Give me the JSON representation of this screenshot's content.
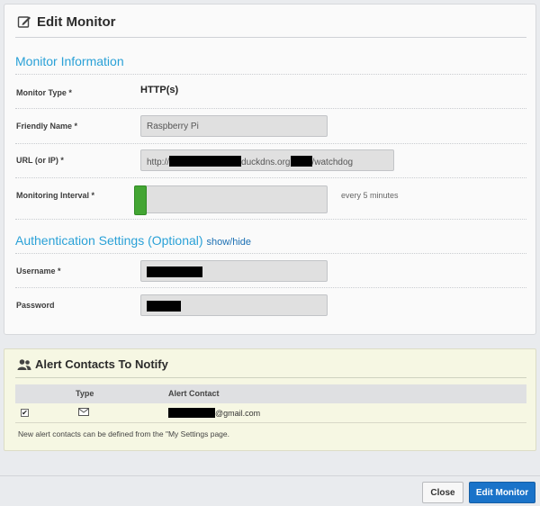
{
  "header": {
    "title": "Edit Monitor",
    "icon": "edit-icon"
  },
  "monitor_info": {
    "section_title": "Monitor Information",
    "type_label": "Monitor Type *",
    "type_value": "HTTP(s)",
    "friendly_name_label": "Friendly Name *",
    "friendly_name_value": "Raspberry Pi",
    "url_label": "URL (or IP) *",
    "url_prefix": "http://",
    "url_mid": "duckdns.org",
    "url_suffix": "/watchdog",
    "interval_label": "Monitoring Interval *",
    "interval_text": "every 5 minutes",
    "interval_slider_level": 0.0
  },
  "auth": {
    "section_title": "Authentication Settings (Optional)",
    "toggle_label": "show/hide",
    "username_label": "Username *",
    "password_label": "Password"
  },
  "alerts": {
    "title": "Alert Contacts To Notify",
    "icon": "users-icon",
    "columns": [
      "",
      "Type",
      "Alert Contact"
    ],
    "rows": [
      {
        "checked": true,
        "type_icon": "envelope-icon",
        "contact_suffix": "@gmail.com"
      }
    ],
    "note": "New alert contacts can be defined from the \"My Settings page."
  },
  "footer": {
    "close_label": "Close",
    "submit_label": "Edit Monitor"
  },
  "colors": {
    "accent": "#2aa1d7",
    "primary_button": "#1a73c9",
    "slider": "#43a533",
    "alert_bg": "#f6f7e3"
  }
}
